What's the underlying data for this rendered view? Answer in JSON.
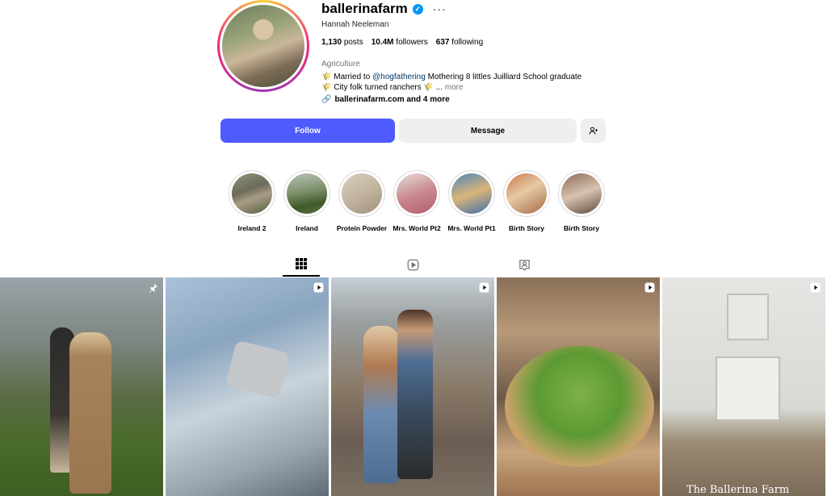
{
  "profile": {
    "username": "ballerinafarm",
    "full_name": "Hannah Neeleman",
    "stats": {
      "posts": "1,130",
      "posts_label": "posts",
      "followers": "10.4M",
      "followers_label": "followers",
      "following": "637",
      "following_label": "following"
    },
    "category": "Agriculture",
    "bio": {
      "line1_prefix": "Married to ",
      "mention": "@hogfathering",
      "line1_suffix": " Mothering 8 littles  Juilliard School graduate",
      "line2": "City folk turned ranchers ",
      "ellipsis": "...",
      "more": "more"
    },
    "link": "ballerinafarm.com and 4 more"
  },
  "actions": {
    "follow_label": "Follow",
    "message_label": "Message"
  },
  "highlights": [
    {
      "label": "Ireland 2"
    },
    {
      "label": "Ireland"
    },
    {
      "label": "Protein Powder"
    },
    {
      "label": "Mrs. World Pt2"
    },
    {
      "label": "Mrs. World Pt1"
    },
    {
      "label": "Birth Story"
    },
    {
      "label": "Birth Story"
    }
  ],
  "tabs": [
    {
      "name": "posts-grid-icon",
      "active": true
    },
    {
      "name": "reels-icon",
      "active": false
    },
    {
      "name": "tagged-icon",
      "active": false
    }
  ],
  "posts": [
    {
      "type": "pinned",
      "icon": "pin-icon"
    },
    {
      "type": "reel",
      "icon": "reel-icon"
    },
    {
      "type": "reel",
      "icon": "reel-icon"
    },
    {
      "type": "reel",
      "icon": "reel-icon"
    },
    {
      "type": "reel",
      "icon": "reel-icon",
      "caption": "The Ballerina Farm"
    }
  ],
  "colors": {
    "follow_button": "#4f5bff",
    "secondary_button": "#efefef",
    "verified": "#0095f6",
    "mention": "#00376b"
  }
}
